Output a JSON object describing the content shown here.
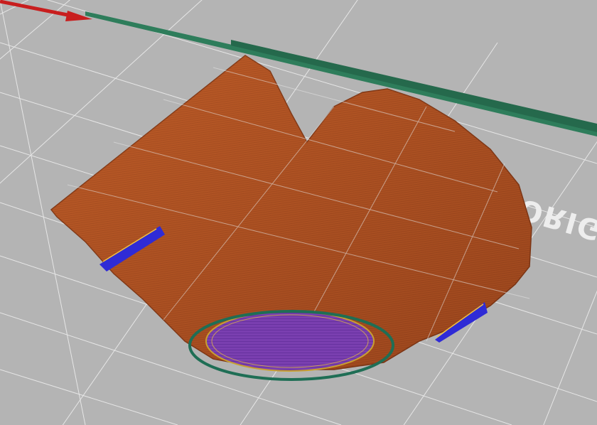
{
  "viewport": {
    "bed_label": "ORIGINAL PRUSA",
    "colors": {
      "background": "#b4b4b4",
      "grid_line": "#e6e6e6",
      "x_axis": "#c81e1e",
      "y_axis": "#2e7d5b",
      "bed_text": "#ededed",
      "part_dark": "#8a3a17",
      "part_mid": "#b35424",
      "part_light": "#cf6a2e",
      "bridge_infill": "#2f2bd6",
      "first_layer": "#7a3fb0",
      "skirt": "#1f6e55"
    },
    "icons": {
      "x_axis": "x-axis-arrow-icon",
      "y_axis": "y-axis-line-icon"
    }
  }
}
